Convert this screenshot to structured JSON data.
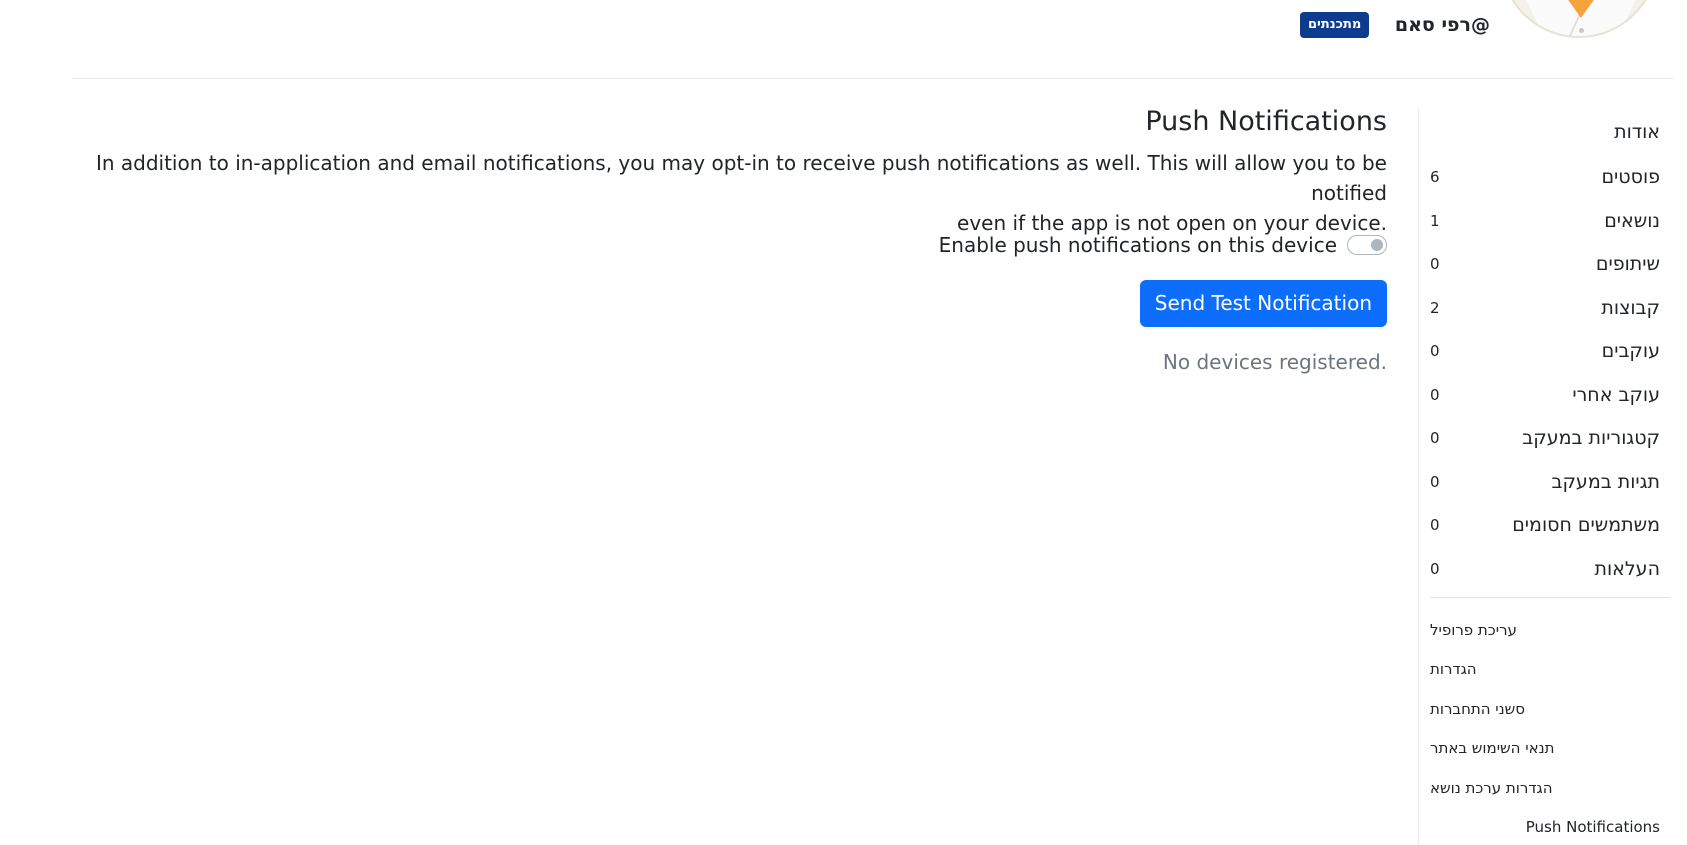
{
  "header": {
    "username": "@רפי סאם",
    "role_badge": "מתכנתים"
  },
  "sidebar": {
    "items": [
      {
        "label": "אודות",
        "count": ""
      },
      {
        "label": "פוסטים",
        "count": "6"
      },
      {
        "label": "נושאים",
        "count": "1"
      },
      {
        "label": "שיתופים",
        "count": "0"
      },
      {
        "label": "קבוצות",
        "count": "2"
      },
      {
        "label": "עוקבים",
        "count": "0"
      },
      {
        "label": "עוקב אחרי",
        "count": "0"
      },
      {
        "label": "קטגוריות במעקב",
        "count": "0"
      },
      {
        "label": "תגיות במעקב",
        "count": "0"
      },
      {
        "label": "משתמשים חסומים",
        "count": "0"
      },
      {
        "label": "העלאות",
        "count": "0"
      }
    ],
    "sub_items": [
      "עריכת פרופיל",
      "הגדרות",
      "סשני התחברות",
      "תנאי השימוש באתר",
      "הגדרות ערכת נושא",
      "Push Notifications"
    ]
  },
  "main": {
    "title": "Push Notifications",
    "description_line1": "In addition to in-application and email notifications, you may opt-in to receive push notifications as well. This will allow you to be notified",
    "description_line2": ".even if the app is not open on your device",
    "toggle_label": "Enable push notifications on this device",
    "send_button": "Send Test Notification",
    "no_devices": ".No devices registered"
  },
  "colors": {
    "primary": "#0d6efd",
    "badge": "#0d3c8f",
    "muted": "#6c757d"
  }
}
